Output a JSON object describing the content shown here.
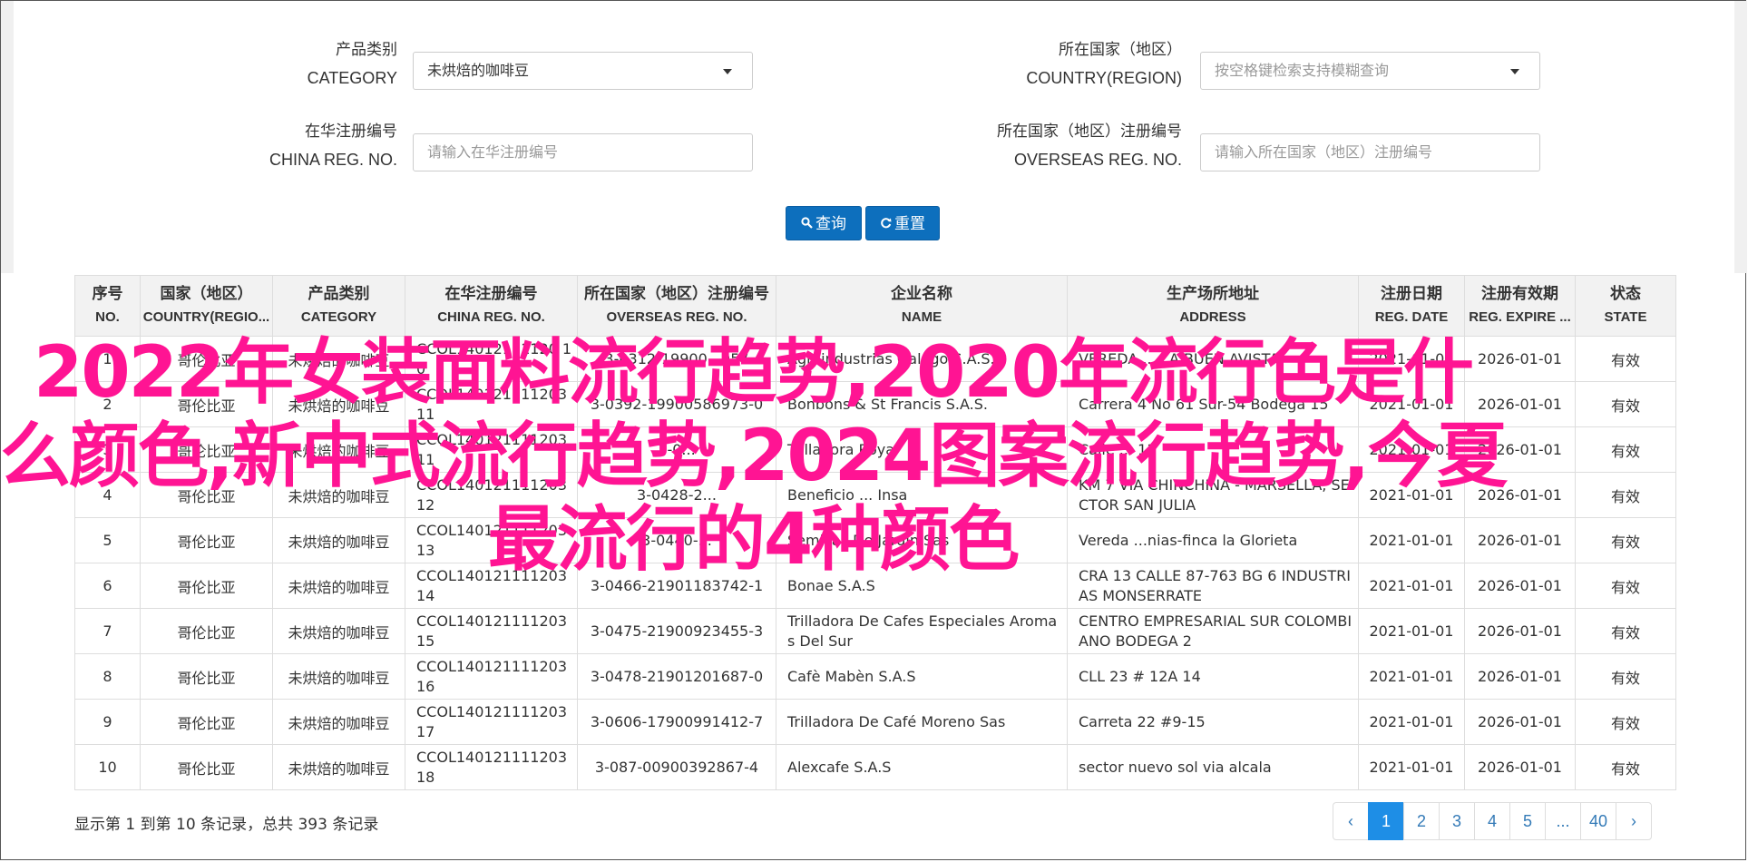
{
  "form": {
    "category": {
      "label_cn": "产品类别",
      "label_en": "CATEGORY",
      "value": "未烘焙的咖啡豆"
    },
    "country": {
      "label_cn": "所在国家（地区）",
      "label_en": "COUNTRY(REGION)",
      "placeholder": "按空格键检索支持模糊查询"
    },
    "china_reg": {
      "label_cn": "在华注册编号",
      "label_en": "CHINA REG. NO.",
      "placeholder": "请输入在华注册编号"
    },
    "overseas_reg": {
      "label_cn": "所在国家（地区）注册编号",
      "label_en": "OVERSEAS REG. NO.",
      "placeholder": "请输入所在国家（地区）注册编号"
    },
    "search_label": "查询",
    "reset_label": "重置"
  },
  "table": {
    "headers": [
      {
        "cn": "序号",
        "en": "NO."
      },
      {
        "cn": "国家（地区）",
        "en": "COUNTRY(REGIO..."
      },
      {
        "cn": "产品类别",
        "en": "CATEGORY"
      },
      {
        "cn": "在华注册编号",
        "en": "CHINA REG. NO."
      },
      {
        "cn": "所在国家（地区）注册编号",
        "en": "OVERSEAS REG. NO."
      },
      {
        "cn": "企业名称",
        "en": "NAME"
      },
      {
        "cn": "生产场所地址",
        "en": "ADDRESS"
      },
      {
        "cn": "注册日期",
        "en": "REG. DATE"
      },
      {
        "cn": "注册有效期",
        "en": "REG. EXPIRE ..."
      },
      {
        "cn": "状态",
        "en": "STATE"
      }
    ],
    "rows": [
      {
        "no": "1",
        "country": "哥伦比亚",
        "category": "未烘焙的咖啡豆",
        "china_reg": "CCOL14012111120 10",
        "overseas_reg": "3-0312-19900...957",
        "name": "Agroindustrias Galago S.A.S.",
        "address": "VEREDA ... LA BUEN AVISTA",
        "reg_date": "2021-01-01",
        "expire": "2026-01-01",
        "state": "有效"
      },
      {
        "no": "2",
        "country": "哥伦比亚",
        "category": "未烘焙的咖啡豆",
        "china_reg": "CCOL140121111203 11",
        "overseas_reg": "3-0392-19900586973-0",
        "name": "Bonbons & St Francis S.A.S.",
        "address": "Carrera 4 No 61 Sur-54 Bodega 15",
        "reg_date": "2021-01-01",
        "expire": "2026-01-01",
        "state": "有效"
      },
      {
        "no": "3",
        "country": "哥伦比亚",
        "category": "未烘焙的咖啡豆",
        "china_reg": "CCOL140121111203 11",
        "overseas_reg": "3-0...",
        "name": "Trilladora Royal",
        "address": "Calle ... 13",
        "reg_date": "2021-01-01",
        "expire": "2026-01-01",
        "state": "有效"
      },
      {
        "no": "4",
        "country": "哥伦比亚",
        "category": "未烘焙的咖啡豆",
        "china_reg": "CCOL140121111203 12",
        "overseas_reg": "3-0428-2...",
        "name": "Beneficio ... Insa",
        "address": "KM 7 VIA CHINCHINA - MARSELLA, SECTOR SAN JULIA",
        "reg_date": "2021-01-01",
        "expire": "2026-01-01",
        "state": "有效"
      },
      {
        "no": "5",
        "country": "哥伦比亚",
        "category": "未烘焙的咖啡豆",
        "china_reg": "CCOL140121111203 13",
        "overseas_reg": "3-0440-...",
        "name": "Semillas De Jardin Sas",
        "address": "Vereda ...nias-finca la Glorieta",
        "reg_date": "2021-01-01",
        "expire": "2026-01-01",
        "state": "有效"
      },
      {
        "no": "6",
        "country": "哥伦比亚",
        "category": "未烘焙的咖啡豆",
        "china_reg": "CCOL140121111203 14",
        "overseas_reg": "3-0466-21901183742-1",
        "name": "Bonae S.A.S",
        "address": "CRA 13 CALLE 87-763 BG 6 INDUSTRIAS MONSERRATE",
        "reg_date": "2021-01-01",
        "expire": "2026-01-01",
        "state": "有效"
      },
      {
        "no": "7",
        "country": "哥伦比亚",
        "category": "未烘焙的咖啡豆",
        "china_reg": "CCOL140121111203 15",
        "overseas_reg": "3-0475-21900923455-3",
        "name": "Trilladora De Cafes Especiales Aromas Del Sur",
        "address": "CENTRO EMPRESARIAL SUR COLOMBIANO BODEGA 2",
        "reg_date": "2021-01-01",
        "expire": "2026-01-01",
        "state": "有效"
      },
      {
        "no": "8",
        "country": "哥伦比亚",
        "category": "未烘焙的咖啡豆",
        "china_reg": "CCOL140121111203 16",
        "overseas_reg": "3-0478-21901201687-0",
        "name": "Cafè Mabèn S.A.S",
        "address": "CLL 23 # 12A 14",
        "reg_date": "2021-01-01",
        "expire": "2026-01-01",
        "state": "有效"
      },
      {
        "no": "9",
        "country": "哥伦比亚",
        "category": "未烘焙的咖啡豆",
        "china_reg": "CCOL140121111203 17",
        "overseas_reg": "3-0606-17900991412-7",
        "name": "Trilladora De Café Moreno Sas",
        "address": "Carreta 22 #9-15",
        "reg_date": "2021-01-01",
        "expire": "2026-01-01",
        "state": "有效"
      },
      {
        "no": "10",
        "country": "哥伦比亚",
        "category": "未烘焙的咖啡豆",
        "china_reg": "CCOL140121111203 18",
        "overseas_reg": "3-087-00900392867-4",
        "name": "Alexcafe S.A.S",
        "address": "sector nuevo sol via alcala",
        "reg_date": "2021-01-01",
        "expire": "2026-01-01",
        "state": "有效"
      }
    ]
  },
  "summary": "显示第 1 到第 10 条记录，总共 393 条记录",
  "pagination": {
    "prev": "‹",
    "pages": [
      "1",
      "2",
      "3",
      "4",
      "5",
      "...",
      "40"
    ],
    "next": "›",
    "active": "1"
  },
  "overlay_title": "2022年女装面料流行趋势,2020年流行色是什么颜色,新中式流行趋势,2024图案流行趋势,今夏最流行的4种颜色",
  "colors": {
    "primary": "#0d6fbd",
    "active_page": "#1e8ee6",
    "overlay": "#ff1493"
  }
}
